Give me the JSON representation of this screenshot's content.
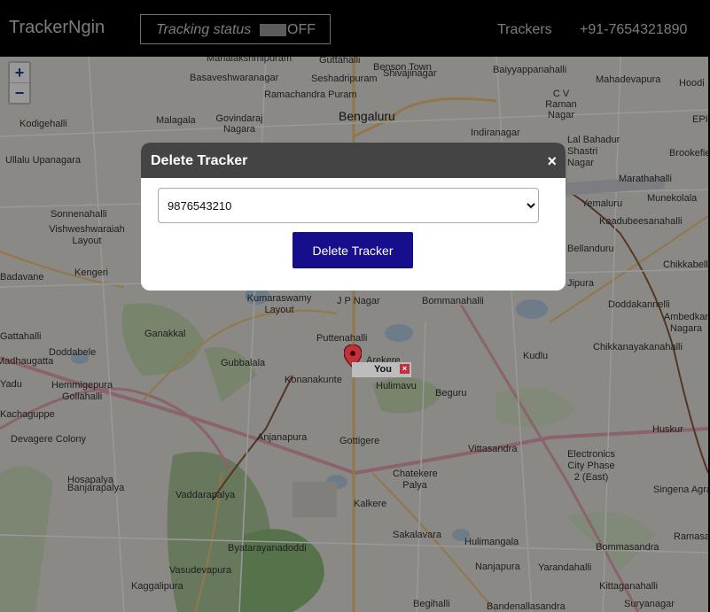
{
  "navbar": {
    "brand": "TrackerNgin",
    "tracking_status_label": "Tracking status",
    "tracking_toggle_text": "OFF",
    "trackers_link": "Trackers",
    "phone": "+91-7654321890"
  },
  "map": {
    "zoom_in": "+",
    "zoom_out": "−",
    "labels": [
      "Mahalakshmipuram",
      "Guttahalli",
      "Benson Town",
      "Baiyyappanahalli",
      "Mahadevapura",
      "Hoodi",
      "Basaveshwaranagar",
      "Seshadripuram",
      "Shivajinagar",
      "C V Raman Nagar",
      "Ramachandra Puram",
      "Malagala",
      "Govindaraj Nagara",
      "Bengaluru",
      "Indiranagar",
      "EPI",
      "Kodigehalli",
      "Ullalu Upanagara",
      "Lal Bahadur Shastri Nagar",
      "Brookefie",
      "Marathahalli",
      "Munekolala",
      "Yemaluru",
      "Kaadubeesanahalli",
      "Sonnenahalli",
      "Vishweshwaraiah Layout",
      "Kengeri",
      "Bellanduru",
      "Chikkabell",
      "Badavane",
      "Kumaraswamy Layout",
      "J P Nagar",
      "Bommanahalli",
      "Doddakannelli",
      "Ambedkar Nagara",
      "Ganakkal",
      "Puttenahalli",
      "Arekere",
      "Hulimavu",
      "Gubbalala",
      "Konanakunte",
      "Beguru",
      "Kudlu",
      "Chikkanayakanahalli",
      "Doddabele",
      "Hemmigepura",
      "Gollahalli",
      "Gattahalli",
      "Kaggalipura",
      "Yarandahalli",
      "Bommasandra",
      "Ramasa",
      "Suryanagar",
      "Kittaganahalli",
      "Begihalli",
      "Bandenallasandra",
      "Sakalavara",
      "Hulimangala",
      "Nanjapura",
      "Chatekere Palya",
      "Kalkere",
      "Vittasandra",
      "Electronics City Phase 2 (East)",
      "Singena Agra",
      "Huskur",
      "Anjanapura",
      "Gottigere",
      "Devagere Colony",
      "Hosapalya",
      "Banjarapalya",
      "Vaddarapalya",
      "Vasudevapura",
      "Byatarayanadoddi",
      "Kachaguppe",
      "Madhaugatta",
      "Yadu",
      "Jipura"
    ],
    "you_label": "You",
    "you_close": "×"
  },
  "modal": {
    "title": "Delete Tracker",
    "close": "×",
    "selected_tracker": "9876543210",
    "delete_button": "Delete Tracker"
  },
  "colors": {
    "navbar_bg": "#000000",
    "modal_header_bg": "#444444",
    "delete_button_bg": "#160e8a",
    "marker_red": "#c0313c"
  }
}
